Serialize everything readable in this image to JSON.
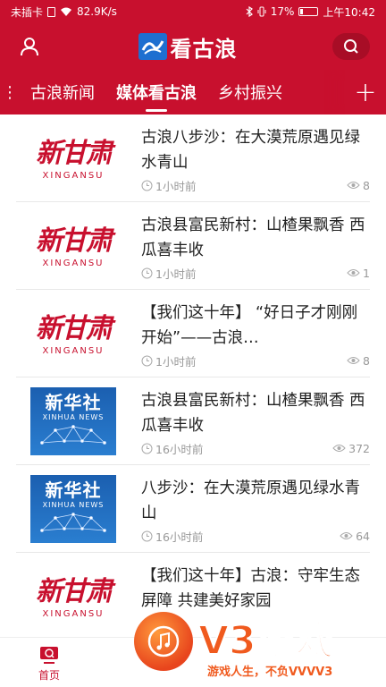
{
  "status": {
    "carrier": "未插卡",
    "speed": "82.9K/s",
    "battery": "17%",
    "time": "上午10:42"
  },
  "header": {
    "app_title": "看古浪"
  },
  "tabs": [
    {
      "label": "古浪新闻"
    },
    {
      "label": "媒体看古浪"
    },
    {
      "label": "乡村振兴"
    },
    {
      "label": "+"
    }
  ],
  "news": [
    {
      "source_mark": "新甘肃",
      "source_sub": "XINGANSU",
      "title": "古浪八步沙：在大漠荒原遇见绿水青山",
      "time": "1小时前",
      "views": "8"
    },
    {
      "source_mark": "新甘肃",
      "source_sub": "XINGANSU",
      "title": "古浪县富民新村：山楂果飘香 西瓜喜丰收",
      "time": "1小时前",
      "views": "1"
    },
    {
      "source_mark": "新甘肃",
      "source_sub": "XINGANSU",
      "title": "【我们这十年】 “好日子才刚刚开始”——古浪…",
      "time": "1小时前",
      "views": "8"
    },
    {
      "source_mark": "新华社",
      "source_sub": "XINHUA NEWS",
      "title": "古浪县富民新村：山楂果飘香 西瓜喜丰收",
      "time": "16小时前",
      "views": "372"
    },
    {
      "source_mark": "新华社",
      "source_sub": "XINHUA NEWS",
      "title": "八步沙：在大漠荒原遇见绿水青山",
      "time": "16小时前",
      "views": "64"
    },
    {
      "source_mark": "新甘肃",
      "source_sub": "XINGANSU",
      "title": "【我们这十年】古浪：守牢生态屏障 共建美好家园",
      "time": "",
      "views": ""
    }
  ],
  "bottom_nav": {
    "home_label": "首页"
  },
  "watermark": {
    "brand": "V3游戏",
    "slogan": "游戏人生，不负VVVV3"
  },
  "colors": {
    "primary": "#c8102e",
    "watermark": "#f05a1e"
  }
}
